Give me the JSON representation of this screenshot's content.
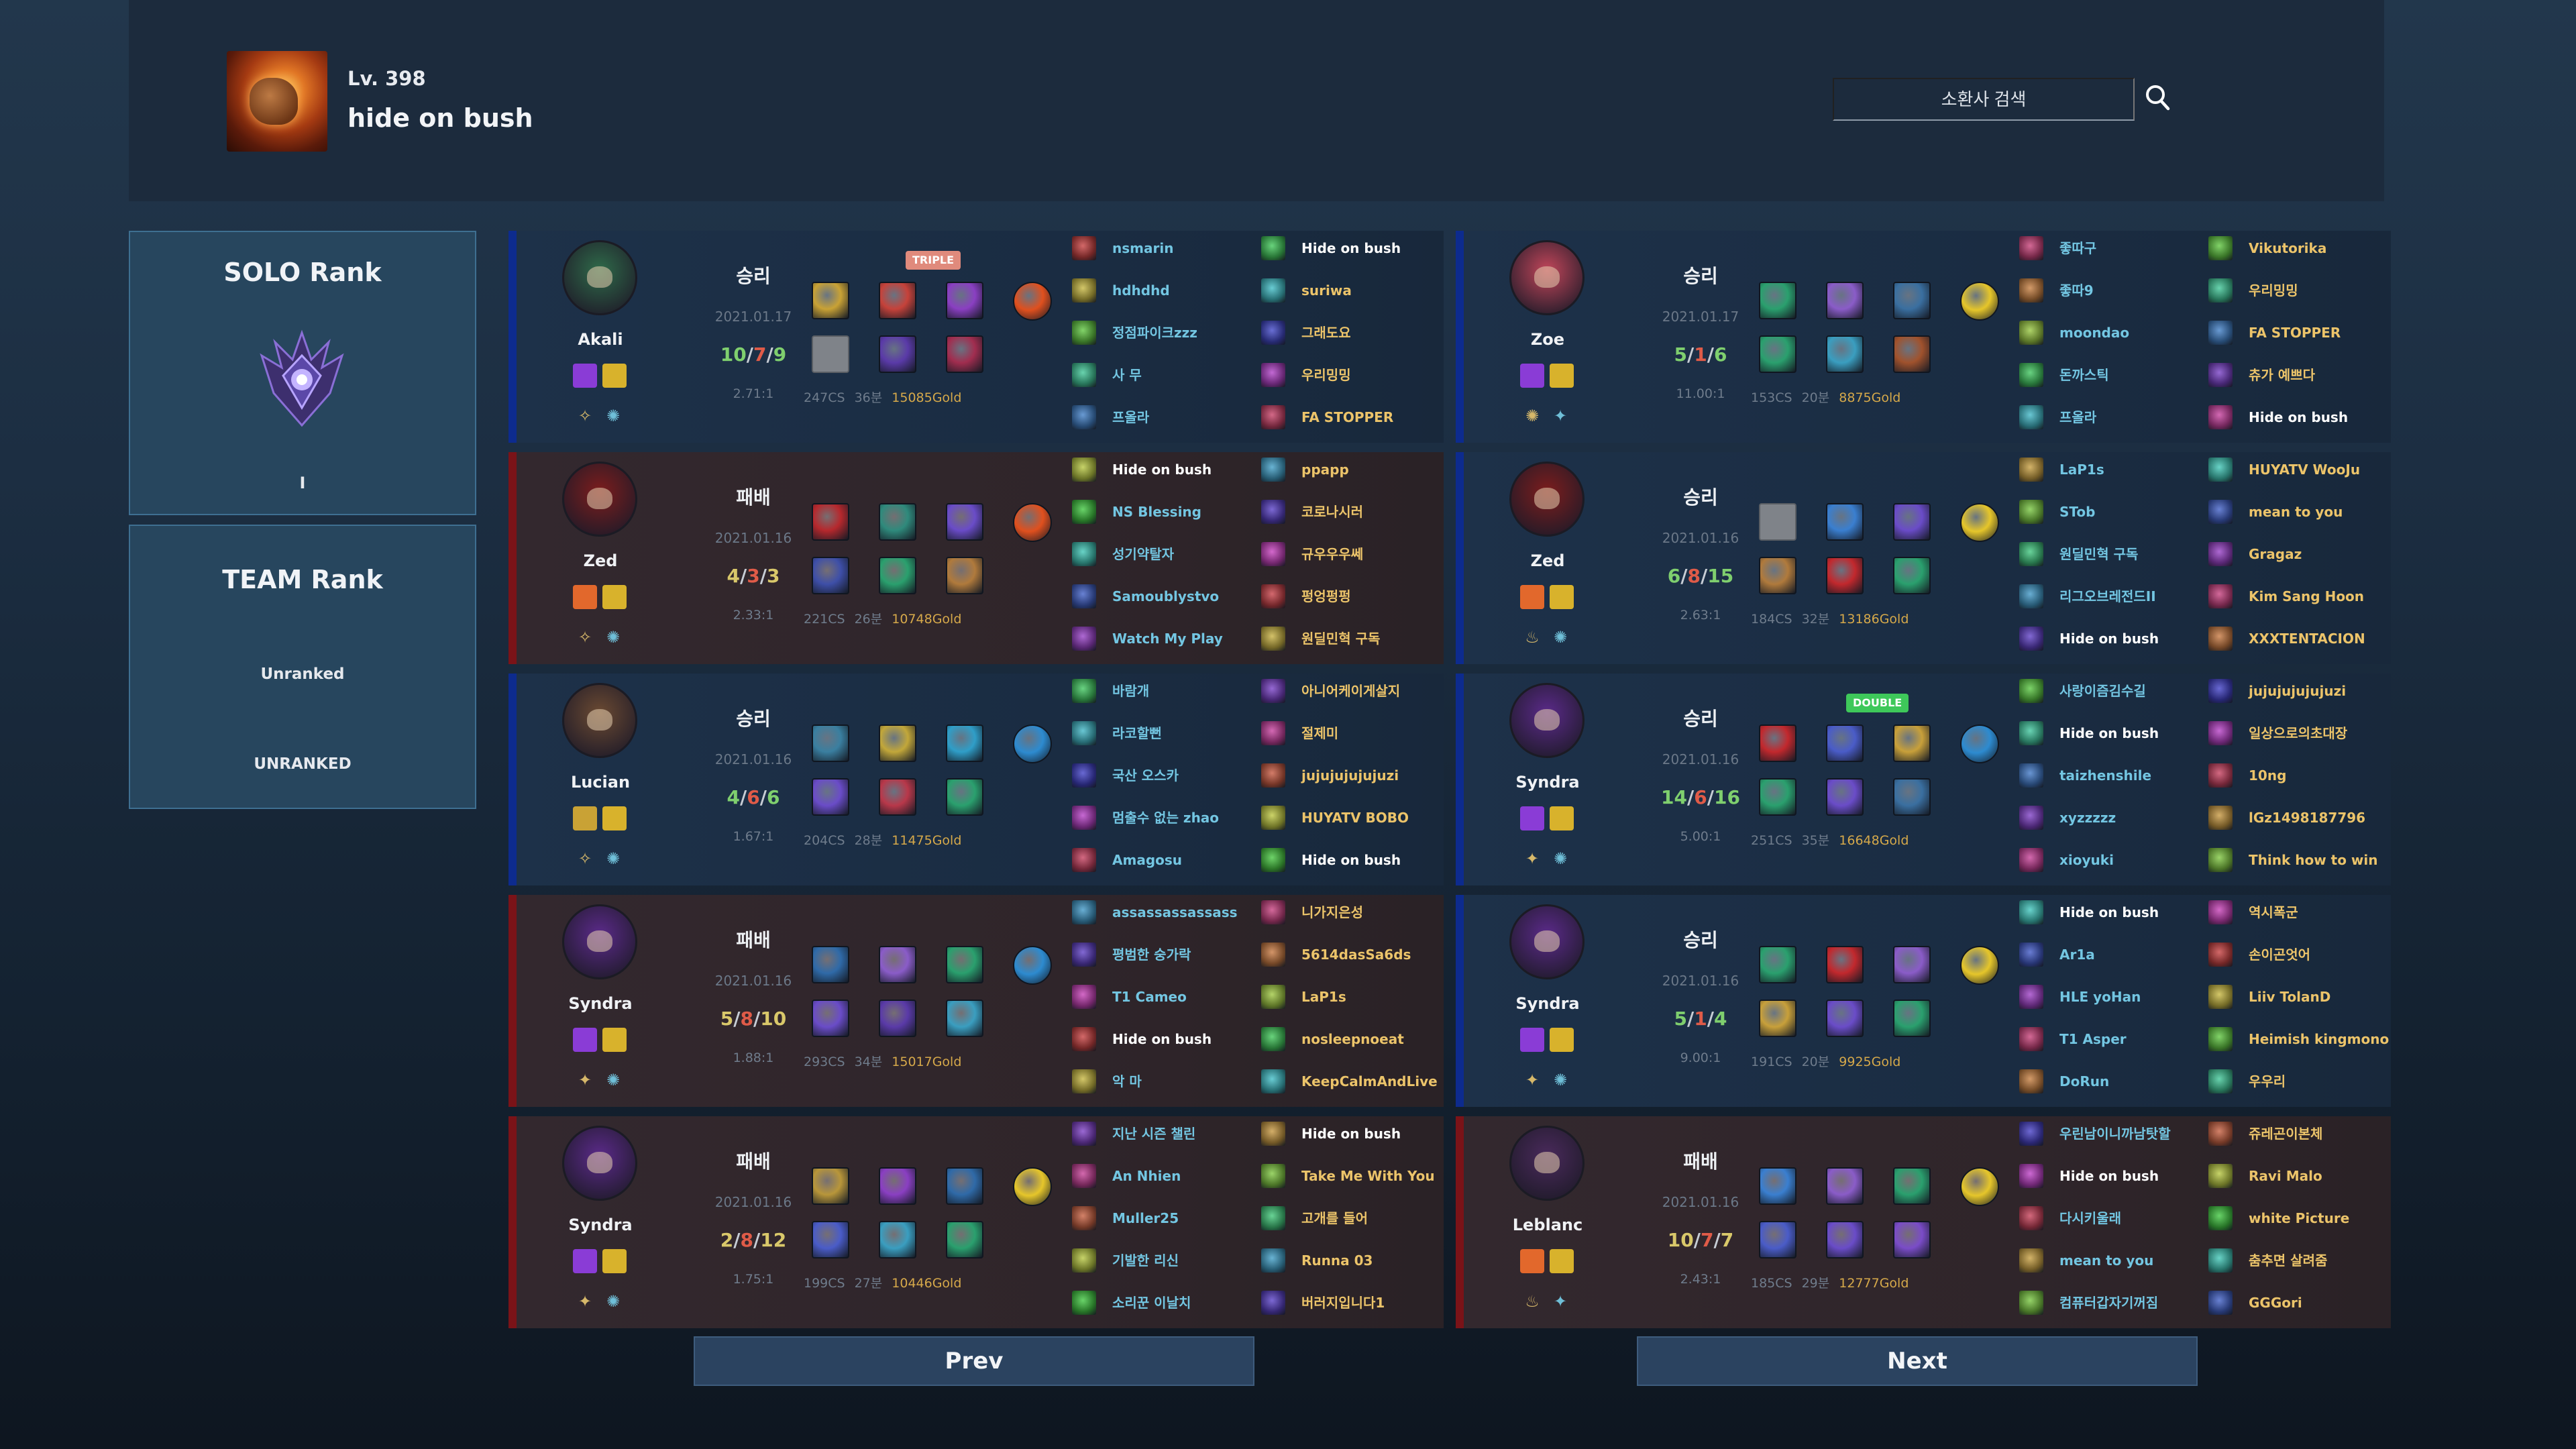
{
  "profile": {
    "level": "Lv. 398",
    "name": "hide on bush"
  },
  "search": {
    "placeholder": "소환사 검색"
  },
  "solo_rank": {
    "title": "SOLO Rank",
    "tier": "I"
  },
  "team_rank": {
    "title": "TEAM Rank",
    "status": "Unranked",
    "tier": "UNRANKED"
  },
  "nav": {
    "prev": "Prev",
    "next": "Next"
  },
  "matches": [
    {
      "champion": "Akali",
      "result": "승리",
      "win": true,
      "date": "2021.01.17",
      "kills": "10",
      "deaths": "7",
      "assists": "9",
      "ratio": "2.71:1",
      "cs": "247CS",
      "duration": "36분",
      "gold": "15085Gold",
      "multikill": "TRIPLE",
      "champ_color": "#2f6b4a",
      "spells": [
        "#8a3cd6",
        "#d8b22c"
      ],
      "runes": [
        "✧",
        "✺"
      ],
      "items": [
        "#c9a235",
        "#c6423a",
        "#8a3fc2",
        "#e0501e",
        "EMPTY",
        "#5a3aa8",
        "#a12d4f"
      ],
      "team1": [
        "nsmarin",
        "hdhdhd",
        "정점파이크zzz",
        "사 무",
        "프올라"
      ],
      "team2": [
        "Hide on bush",
        "suriwa",
        "그래도요",
        "우리밍밍",
        "FA STOPPER"
      ]
    },
    {
      "champion": "Zed",
      "result": "패배",
      "win": false,
      "date": "2021.01.16",
      "kills": "4",
      "deaths": "3",
      "assists": "3",
      "ratio": "2.33:1",
      "cs": "221CS",
      "duration": "26분",
      "gold": "10748Gold",
      "multikill": "",
      "champ_color": "#7d1d1d",
      "spells": [
        "#e2682c",
        "#d8b22c"
      ],
      "runes": [
        "✧",
        "✺"
      ],
      "items": [
        "#b6282d",
        "#2f8a7c",
        "#6a4cc8",
        "#e0501e",
        "#3e4fa8",
        "#2aa06e",
        "#b07a3c"
      ],
      "team1": [
        "Hide on bush",
        "NS Blessing",
        "성기약탈자",
        "Samoublystvo",
        "Watch My Play"
      ],
      "team2": [
        "ppapp",
        "코로나시러",
        "규우우우쎄",
        "펑엉펑펑",
        "원딜민혁 구독"
      ]
    },
    {
      "champion": "Lucian",
      "result": "승리",
      "win": true,
      "date": "2021.01.16",
      "kills": "4",
      "deaths": "6",
      "assists": "6",
      "ratio": "1.67:1",
      "cs": "204CS",
      "duration": "28분",
      "gold": "11475Gold",
      "multikill": "",
      "champ_color": "#6b4a32",
      "spells": [
        "#c9a235",
        "#d8b22c"
      ],
      "runes": [
        "✧",
        "✺"
      ],
      "items": [
        "#3a7fa0",
        "#c2a73a",
        "#2f9ec8",
        "#2d8bd0",
        "#6a4cc8",
        "#b8384a",
        "#2aa06e"
      ],
      "team1": [
        "바람개",
        "라코할뻔",
        "국산 오스카",
        "멈출수 없는 zhao",
        "Amagosu"
      ],
      "team2": [
        "아니어케이게살지",
        "절제미",
        "jujujujujujuzi",
        "HUYATV BOBO",
        "Hide on bush"
      ]
    },
    {
      "champion": "Syndra",
      "result": "패배",
      "win": false,
      "date": "2021.01.16",
      "kills": "5",
      "deaths": "8",
      "assists": "10",
      "ratio": "1.88:1",
      "cs": "293CS",
      "duration": "34분",
      "gold": "15017Gold",
      "multikill": "",
      "champ_color": "#5b2a8a",
      "spells": [
        "#8a3cd6",
        "#d8b22c"
      ],
      "runes": [
        "✦",
        "✺"
      ],
      "items": [
        "#2f6aa8",
        "#8a5cc8",
        "#2aa06e",
        "#2d8bd0",
        "#6a4cc8",
        "#5a3aa8",
        "#3a9ec0"
      ],
      "team1": [
        "assassassassass",
        "평범한 숭가락",
        "T1 Cameo",
        "Hide on bush",
        "악 마"
      ],
      "team2": [
        "니가지은성",
        "5614dasSa6ds",
        "LaP1s",
        "nosleepnoeat",
        "KeepCalmAndLive"
      ]
    },
    {
      "champion": "Syndra",
      "result": "패배",
      "win": false,
      "date": "2021.01.16",
      "kills": "2",
      "deaths": "8",
      "assists": "12",
      "ratio": "1.75:1",
      "cs": "199CS",
      "duration": "27분",
      "gold": "10446Gold",
      "multikill": "",
      "champ_color": "#5b2a8a",
      "spells": [
        "#8a3cd6",
        "#d8b22c"
      ],
      "runes": [
        "✦",
        "✺"
      ],
      "items": [
        "#b8963a",
        "#8a3fc2",
        "#2f6aa8",
        "#e6c62a",
        "#4a5cc8",
        "#3a9ec0",
        "#2aa06e"
      ],
      "team1": [
        "지난 시즌 챌린",
        "An Nhien",
        "Muller25",
        "기발한 리신",
        "소리꾼 이날치"
      ],
      "team2": [
        "Hide on bush",
        "Take Me With You",
        "고개를 들어",
        "Runna 03",
        "버러지입니다1"
      ]
    },
    {
      "champion": "Zoe",
      "result": "승리",
      "win": true,
      "date": "2021.01.17",
      "kills": "5",
      "deaths": "1",
      "assists": "6",
      "ratio": "11.00:1",
      "cs": "153CS",
      "duration": "20분",
      "gold": "8875Gold",
      "multikill": "",
      "champ_color": "#c2465a",
      "spells": [
        "#8a3cd6",
        "#d8b22c"
      ],
      "runes": [
        "✺",
        "✦"
      ],
      "items": [
        "#2aa06e",
        "#8a5cc8",
        "#3a6fa0",
        "#e6c62a",
        "#2aa06e",
        "#3a9ec0",
        "#a0522d"
      ],
      "team1": [
        "좋따구",
        "좋따9",
        "moondao",
        "돈까스틱",
        "프올라"
      ],
      "team2": [
        "Vikutorika",
        "우리밍밍",
        "FA STOPPER",
        "츄가 예쁘다",
        "Hide on bush"
      ]
    },
    {
      "champion": "Zed",
      "result": "승리",
      "win": true,
      "date": "2021.01.16",
      "kills": "6",
      "deaths": "8",
      "assists": "15",
      "ratio": "2.63:1",
      "cs": "184CS",
      "duration": "32분",
      "gold": "13186Gold",
      "multikill": "",
      "champ_color": "#7d1d1d",
      "spells": [
        "#e2682c",
        "#d8b22c"
      ],
      "runes": [
        "♨",
        "✺"
      ],
      "items": [
        "EMPTY",
        "#3a7fd0",
        "#6a4cc8",
        "#e6c62a",
        "#b07a3c",
        "#c2282d",
        "#2aa06e"
      ],
      "team1": [
        "LaP1s",
        "STob",
        "원딜민혁 구독",
        "리그오브레전드II",
        "Hide on bush"
      ],
      "team2": [
        "HUYATV WooJu",
        "mean to you",
        "Gragaz",
        "Kim Sang Hoon",
        "XXXTENTACION"
      ]
    },
    {
      "champion": "Syndra",
      "result": "승리",
      "win": true,
      "date": "2021.01.16",
      "kills": "14",
      "deaths": "6",
      "assists": "16",
      "ratio": "5.00:1",
      "cs": "251CS",
      "duration": "35분",
      "gold": "16648Gold",
      "multikill": "DOUBLE",
      "champ_color": "#5b2a8a",
      "spells": [
        "#8a3cd6",
        "#d8b22c"
      ],
      "runes": [
        "✦",
        "✺"
      ],
      "items": [
        "#c2282d",
        "#4a5cc8",
        "#c8a03a",
        "#2d8bd0",
        "#2aa06e",
        "#6a4cc8",
        "#3a6fa0"
      ],
      "team1": [
        "사랑이즘김수길",
        "Hide on bush",
        "taizhenshile",
        "xyzzzzz",
        "xioyuki"
      ],
      "team2": [
        "jujujujujujuzi",
        "일상으로의초대장",
        "10ng",
        "lGz1498187796",
        "Think how to win"
      ]
    },
    {
      "champion": "Syndra",
      "result": "승리",
      "win": true,
      "date": "2021.01.16",
      "kills": "5",
      "deaths": "1",
      "assists": "4",
      "ratio": "9.00:1",
      "cs": "191CS",
      "duration": "20분",
      "gold": "9925Gold",
      "multikill": "",
      "champ_color": "#5b2a8a",
      "spells": [
        "#8a3cd6",
        "#d8b22c"
      ],
      "runes": [
        "✦",
        "✺"
      ],
      "items": [
        "#2aa06e",
        "#c2282d",
        "#8a5cc8",
        "#e6c62a",
        "#c8a03a",
        "#6a4cc8",
        "#2aa06e"
      ],
      "team1": [
        "Hide on bush",
        "Ar1a",
        "HLE yoHan",
        "T1 Asper",
        "DoRun"
      ],
      "team2": [
        "역시폭군",
        "손이곤엇어",
        "Liiv TolanD",
        "Heimish kingmono",
        "우우리"
      ]
    },
    {
      "champion": "Leblanc",
      "result": "패배",
      "win": false,
      "date": "2021.01.16",
      "kills": "10",
      "deaths": "7",
      "assists": "7",
      "ratio": "2.43:1",
      "cs": "185CS",
      "duration": "29분",
      "gold": "12777Gold",
      "multikill": "",
      "champ_color": "#4a2a5c",
      "spells": [
        "#e2682c",
        "#d8b22c"
      ],
      "runes": [
        "♨",
        "✦"
      ],
      "items": [
        "#3a7fd0",
        "#8a5cc8",
        "#2aa06e",
        "#e6c62a",
        "#4a5cc8",
        "#6a4cc8",
        "#7a4cc8"
      ],
      "team1": [
        "우린남이니까남탓할",
        "Hide on bush",
        "다시키울래",
        "mean to you",
        "컴퓨터갑자기꺼짐"
      ],
      "team2": [
        "쥬레곤이본체",
        "Ravi Malo",
        "white Picture",
        "춤추면 살려줌",
        "GGGori"
      ]
    }
  ]
}
